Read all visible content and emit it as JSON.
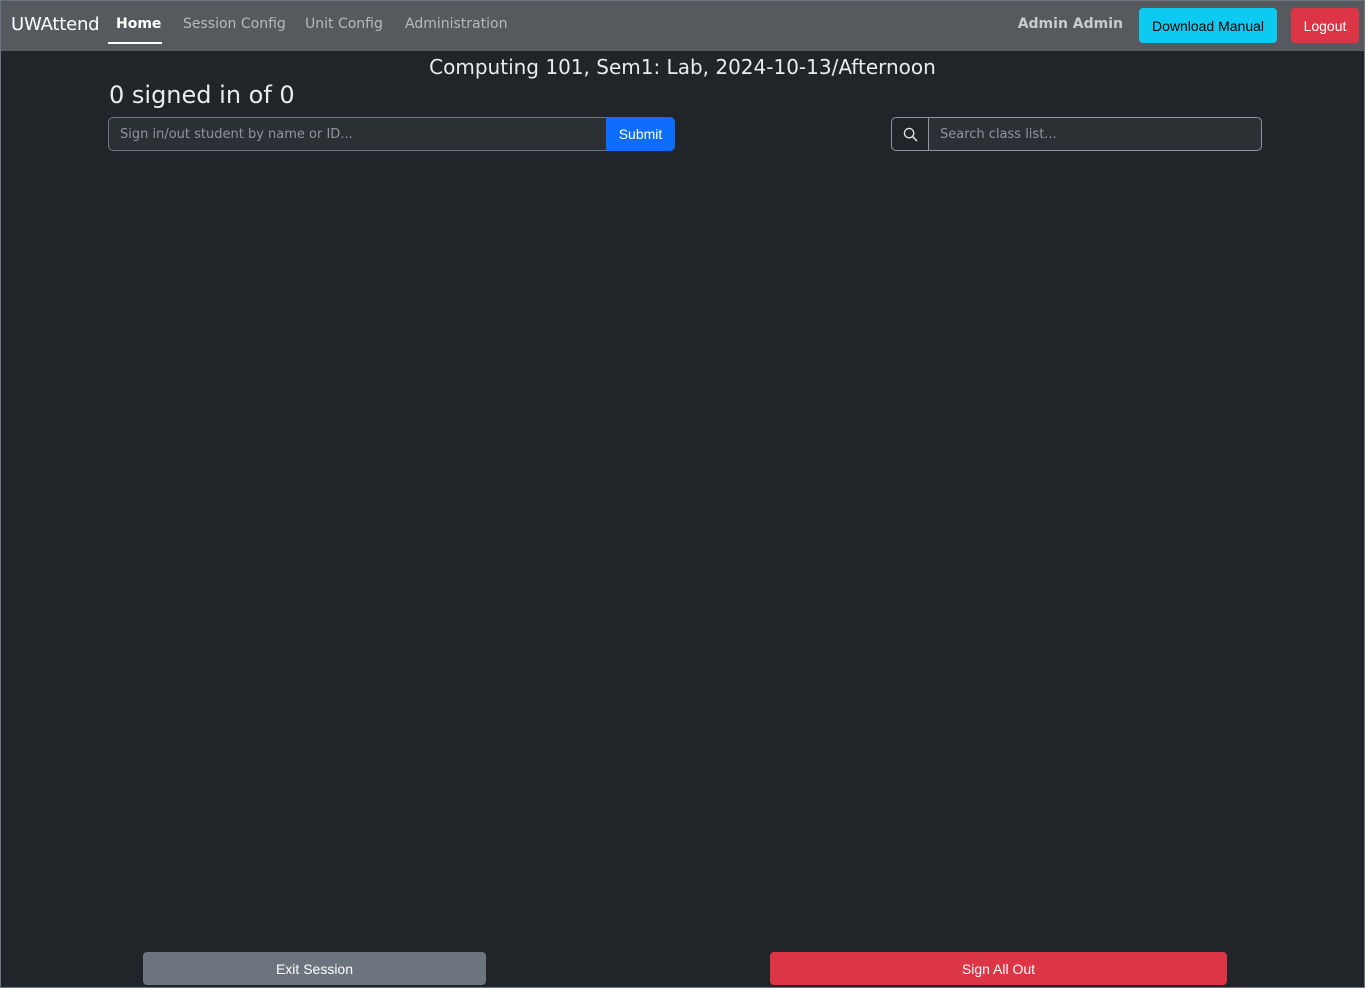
{
  "navbar": {
    "brand": "UWAttend",
    "items": [
      {
        "label": "Home",
        "active": true
      },
      {
        "label": "Session Config",
        "active": false
      },
      {
        "label": "Unit Config",
        "active": false
      },
      {
        "label": "Administration",
        "active": false
      }
    ],
    "user_name": "Admin Admin",
    "download_manual_label": "Download Manual",
    "logout_label": "Logout"
  },
  "session": {
    "title": "Computing 101, Sem1: Lab, 2024-10-13/Afternoon",
    "count_text": "0 signed in of 0"
  },
  "signin": {
    "placeholder": "Sign in/out student by name or ID...",
    "value": "",
    "submit_label": "Submit"
  },
  "class_search": {
    "icon": "search-icon",
    "placeholder": "Search class list...",
    "value": ""
  },
  "footer": {
    "exit_label": "Exit Session",
    "sign_all_out_label": "Sign All Out"
  },
  "colors": {
    "background": "#212529",
    "navbar": "#565a5e",
    "info": "#0dcaf0",
    "danger": "#dc3545",
    "primary": "#0d6efd",
    "secondary": "#6c757d"
  }
}
